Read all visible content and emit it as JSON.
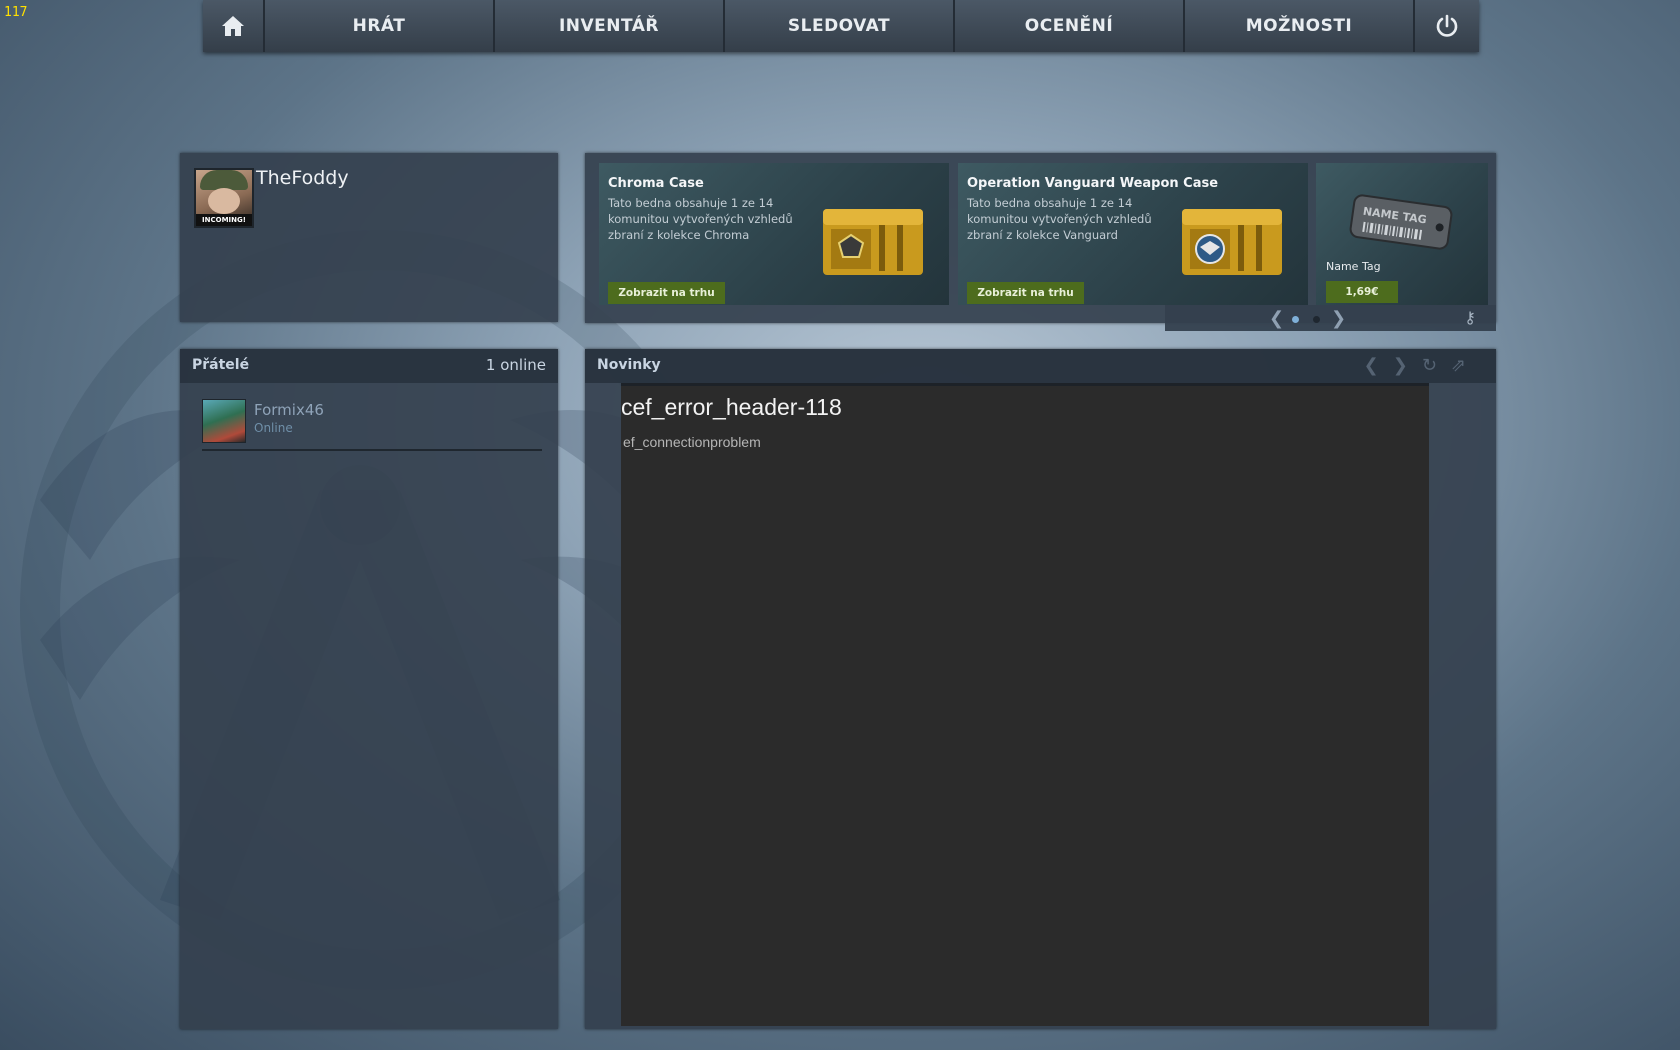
{
  "fps_counter": "117",
  "nav": {
    "tabs": [
      "HRÁT",
      "INVENTÁŘ",
      "SLEDOVAT",
      "OCENĚNÍ",
      "MOŽNOSTI"
    ]
  },
  "profile": {
    "username": "TheFoddy",
    "avatar_caption": "INCOMING!"
  },
  "promo": {
    "cards": [
      {
        "title": "Chroma Case",
        "description": "Tato bedna obsahuje 1 ze 14 komunitou vytvořených vzhledů zbraní z kolekce Chroma",
        "button": "Zobrazit na trhu"
      },
      {
        "title": "Operation Vanguard Weapon Case",
        "description": "Tato bedna obsahuje 1 ze 14 komunitou vytvořených vzhledů zbraní z kolekce Vanguard",
        "button": "Zobrazit na trhu"
      },
      {
        "title": "Name Tag",
        "tag_text": "NAME TAG",
        "price": "1,69€"
      }
    ],
    "page_count": 2,
    "active_page": 1
  },
  "friends": {
    "title": "Přátelé",
    "count": "1 online",
    "list": [
      {
        "name": "Formix46",
        "status": "Online"
      }
    ]
  },
  "news": {
    "title": "Novinky",
    "error_header": "cef_error_header-118",
    "error_message": "ef_connectionproblem"
  },
  "colors": {
    "nav_bg": "#3f4a56",
    "panel_bg": "#34404e",
    "market_button": "#4d6c1d",
    "fps": "#ffe000"
  }
}
